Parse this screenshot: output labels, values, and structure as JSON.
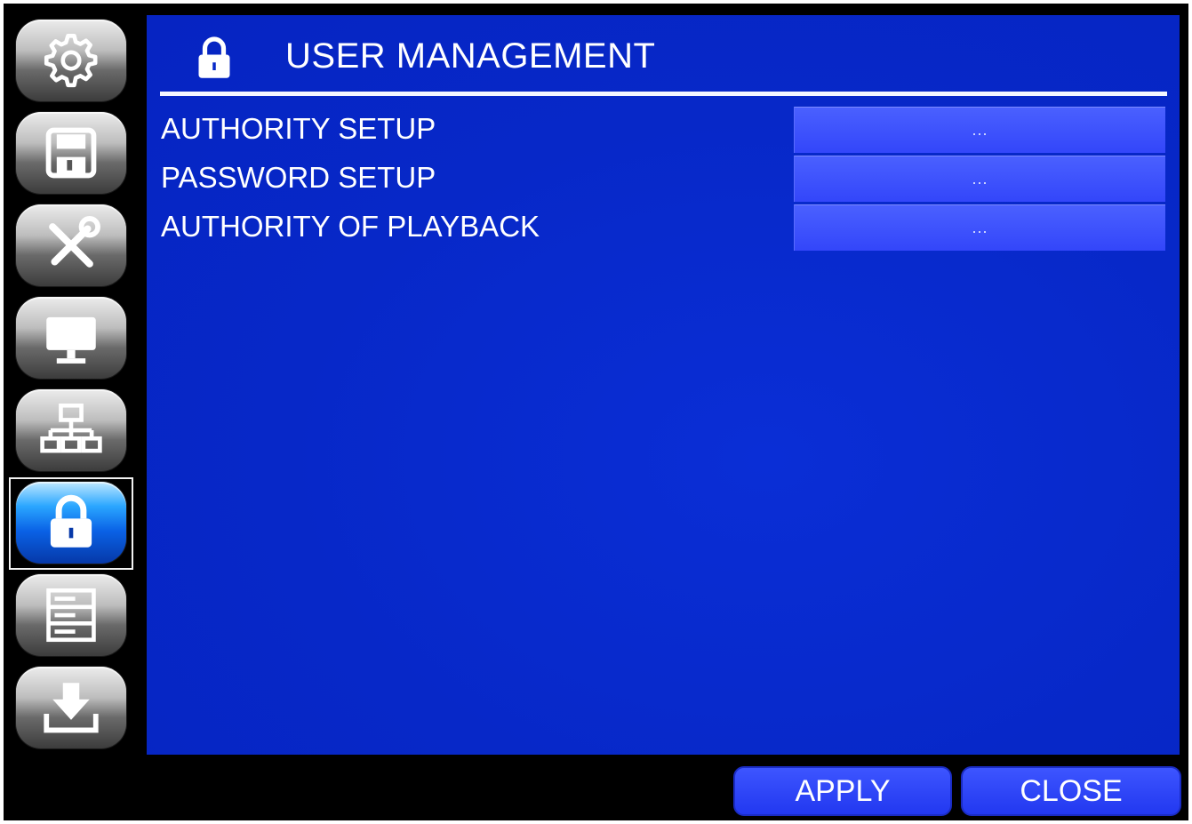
{
  "sidebar": {
    "items": [
      {
        "name": "settings",
        "icon": "gear-icon"
      },
      {
        "name": "storage",
        "icon": "floppy-disk-icon"
      },
      {
        "name": "tools",
        "icon": "tools-icon"
      },
      {
        "name": "display",
        "icon": "monitor-icon"
      },
      {
        "name": "network",
        "icon": "network-icon"
      },
      {
        "name": "user-management",
        "icon": "lock-icon",
        "active": true
      },
      {
        "name": "system-info",
        "icon": "list-panel-icon"
      },
      {
        "name": "download",
        "icon": "download-icon"
      }
    ]
  },
  "header": {
    "icon": "lock-icon",
    "title": "USER MANAGEMENT"
  },
  "rows": [
    {
      "label": "AUTHORITY SETUP",
      "button": "..."
    },
    {
      "label": "PASSWORD SETUP",
      "button": "..."
    },
    {
      "label": "AUTHORITY OF PLAYBACK",
      "button": "..."
    }
  ],
  "footer": {
    "apply_label": "APPLY",
    "close_label": "CLOSE"
  },
  "colors": {
    "panel_background": "#0728c8",
    "row_button": "#3346fa",
    "footer_button": "#2238f0",
    "active_sidebar": "#0a62e6",
    "screen_background": "#000000"
  }
}
